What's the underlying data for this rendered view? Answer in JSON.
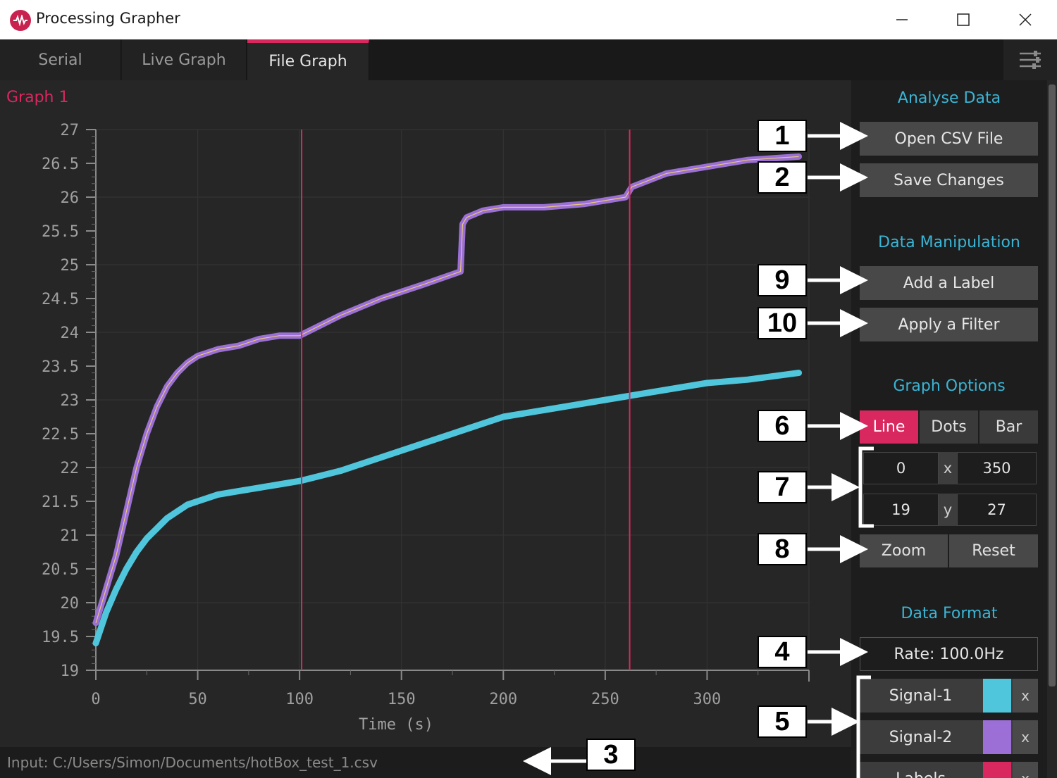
{
  "window": {
    "title": "Processing Grapher"
  },
  "tabs": [
    {
      "label": "Serial",
      "active": false
    },
    {
      "label": "Live Graph",
      "active": false
    },
    {
      "label": "File Graph",
      "active": true
    }
  ],
  "graph": {
    "title": "Graph 1"
  },
  "status": {
    "text": "Input: C:/Users/Simon/Documents/hotBox_test_1.csv"
  },
  "sidebar": {
    "analyse_title": "Analyse Data",
    "open_csv": "Open CSV File",
    "save_changes": "Save Changes",
    "manip_title": "Data Manipulation",
    "add_label": "Add a Label",
    "apply_filter": "Apply a Filter",
    "graph_options_title": "Graph Options",
    "graph_types": [
      "Line",
      "Dots",
      "Bar"
    ],
    "selected_graph_type": "Line",
    "x_min": "0",
    "x_label": "x",
    "x_max": "350",
    "y_min": "19",
    "y_label": "y",
    "y_max": "27",
    "zoom": "Zoom",
    "reset": "Reset",
    "format_title": "Data Format",
    "rate": "Rate: 100.0Hz",
    "signals": [
      {
        "name": "Signal-1",
        "color": "#4fc6dc",
        "remove": "x"
      },
      {
        "name": "Signal-2",
        "color": "#9b6fd6",
        "remove": "x"
      },
      {
        "name": "Labels",
        "color": "#d9285f",
        "remove": "x"
      }
    ]
  },
  "annotations": [
    "1",
    "2",
    "9",
    "10",
    "6",
    "7",
    "8",
    "4",
    "5",
    "3"
  ],
  "colors": {
    "accent": "#d9285f",
    "section_title": "#3ab4d4",
    "signal1": "#4fc6dc",
    "signal2": "#9b6fd6",
    "signal2_mean": "#e8c87a"
  },
  "chart_data": {
    "type": "line",
    "xlabel": "Time (s)",
    "ylabel": "",
    "xlim": [
      0,
      350
    ],
    "ylim": [
      19,
      27
    ],
    "xticks": [
      "0",
      "50",
      "100",
      "150",
      "200",
      "250",
      "300"
    ],
    "yticks": [
      "19",
      "19.5",
      "20",
      "20.5",
      "21",
      "21.5",
      "22",
      "22.5",
      "23",
      "23.5",
      "24",
      "24.5",
      "25",
      "25.5",
      "26",
      "26.5",
      "27"
    ],
    "label_markers": [
      101,
      262
    ],
    "series": [
      {
        "name": "Signal-1",
        "x": [
          0,
          5,
          10,
          15,
          20,
          25,
          30,
          35,
          40,
          45,
          50,
          60,
          70,
          80,
          90,
          100,
          120,
          140,
          160,
          180,
          200,
          220,
          240,
          260,
          280,
          300,
          320,
          345
        ],
        "values": [
          19.4,
          19.85,
          20.2,
          20.5,
          20.75,
          20.95,
          21.1,
          21.25,
          21.35,
          21.45,
          21.5,
          21.6,
          21.65,
          21.7,
          21.75,
          21.8,
          21.95,
          22.15,
          22.35,
          22.55,
          22.75,
          22.85,
          22.95,
          23.05,
          23.15,
          23.25,
          23.3,
          23.4
        ]
      },
      {
        "name": "Signal-2",
        "x": [
          0,
          10,
          20,
          25,
          30,
          35,
          40,
          45,
          50,
          60,
          70,
          80,
          90,
          100,
          120,
          140,
          160,
          179,
          180,
          182,
          190,
          200,
          220,
          240,
          260,
          263,
          280,
          300,
          320,
          345
        ],
        "values": [
          19.7,
          20.7,
          22.0,
          22.5,
          22.9,
          23.2,
          23.4,
          23.55,
          23.65,
          23.75,
          23.8,
          23.9,
          23.95,
          23.95,
          24.25,
          24.5,
          24.7,
          24.9,
          25.6,
          25.7,
          25.8,
          25.85,
          25.85,
          25.9,
          26.0,
          26.15,
          26.35,
          26.45,
          26.55,
          26.6
        ]
      }
    ]
  }
}
